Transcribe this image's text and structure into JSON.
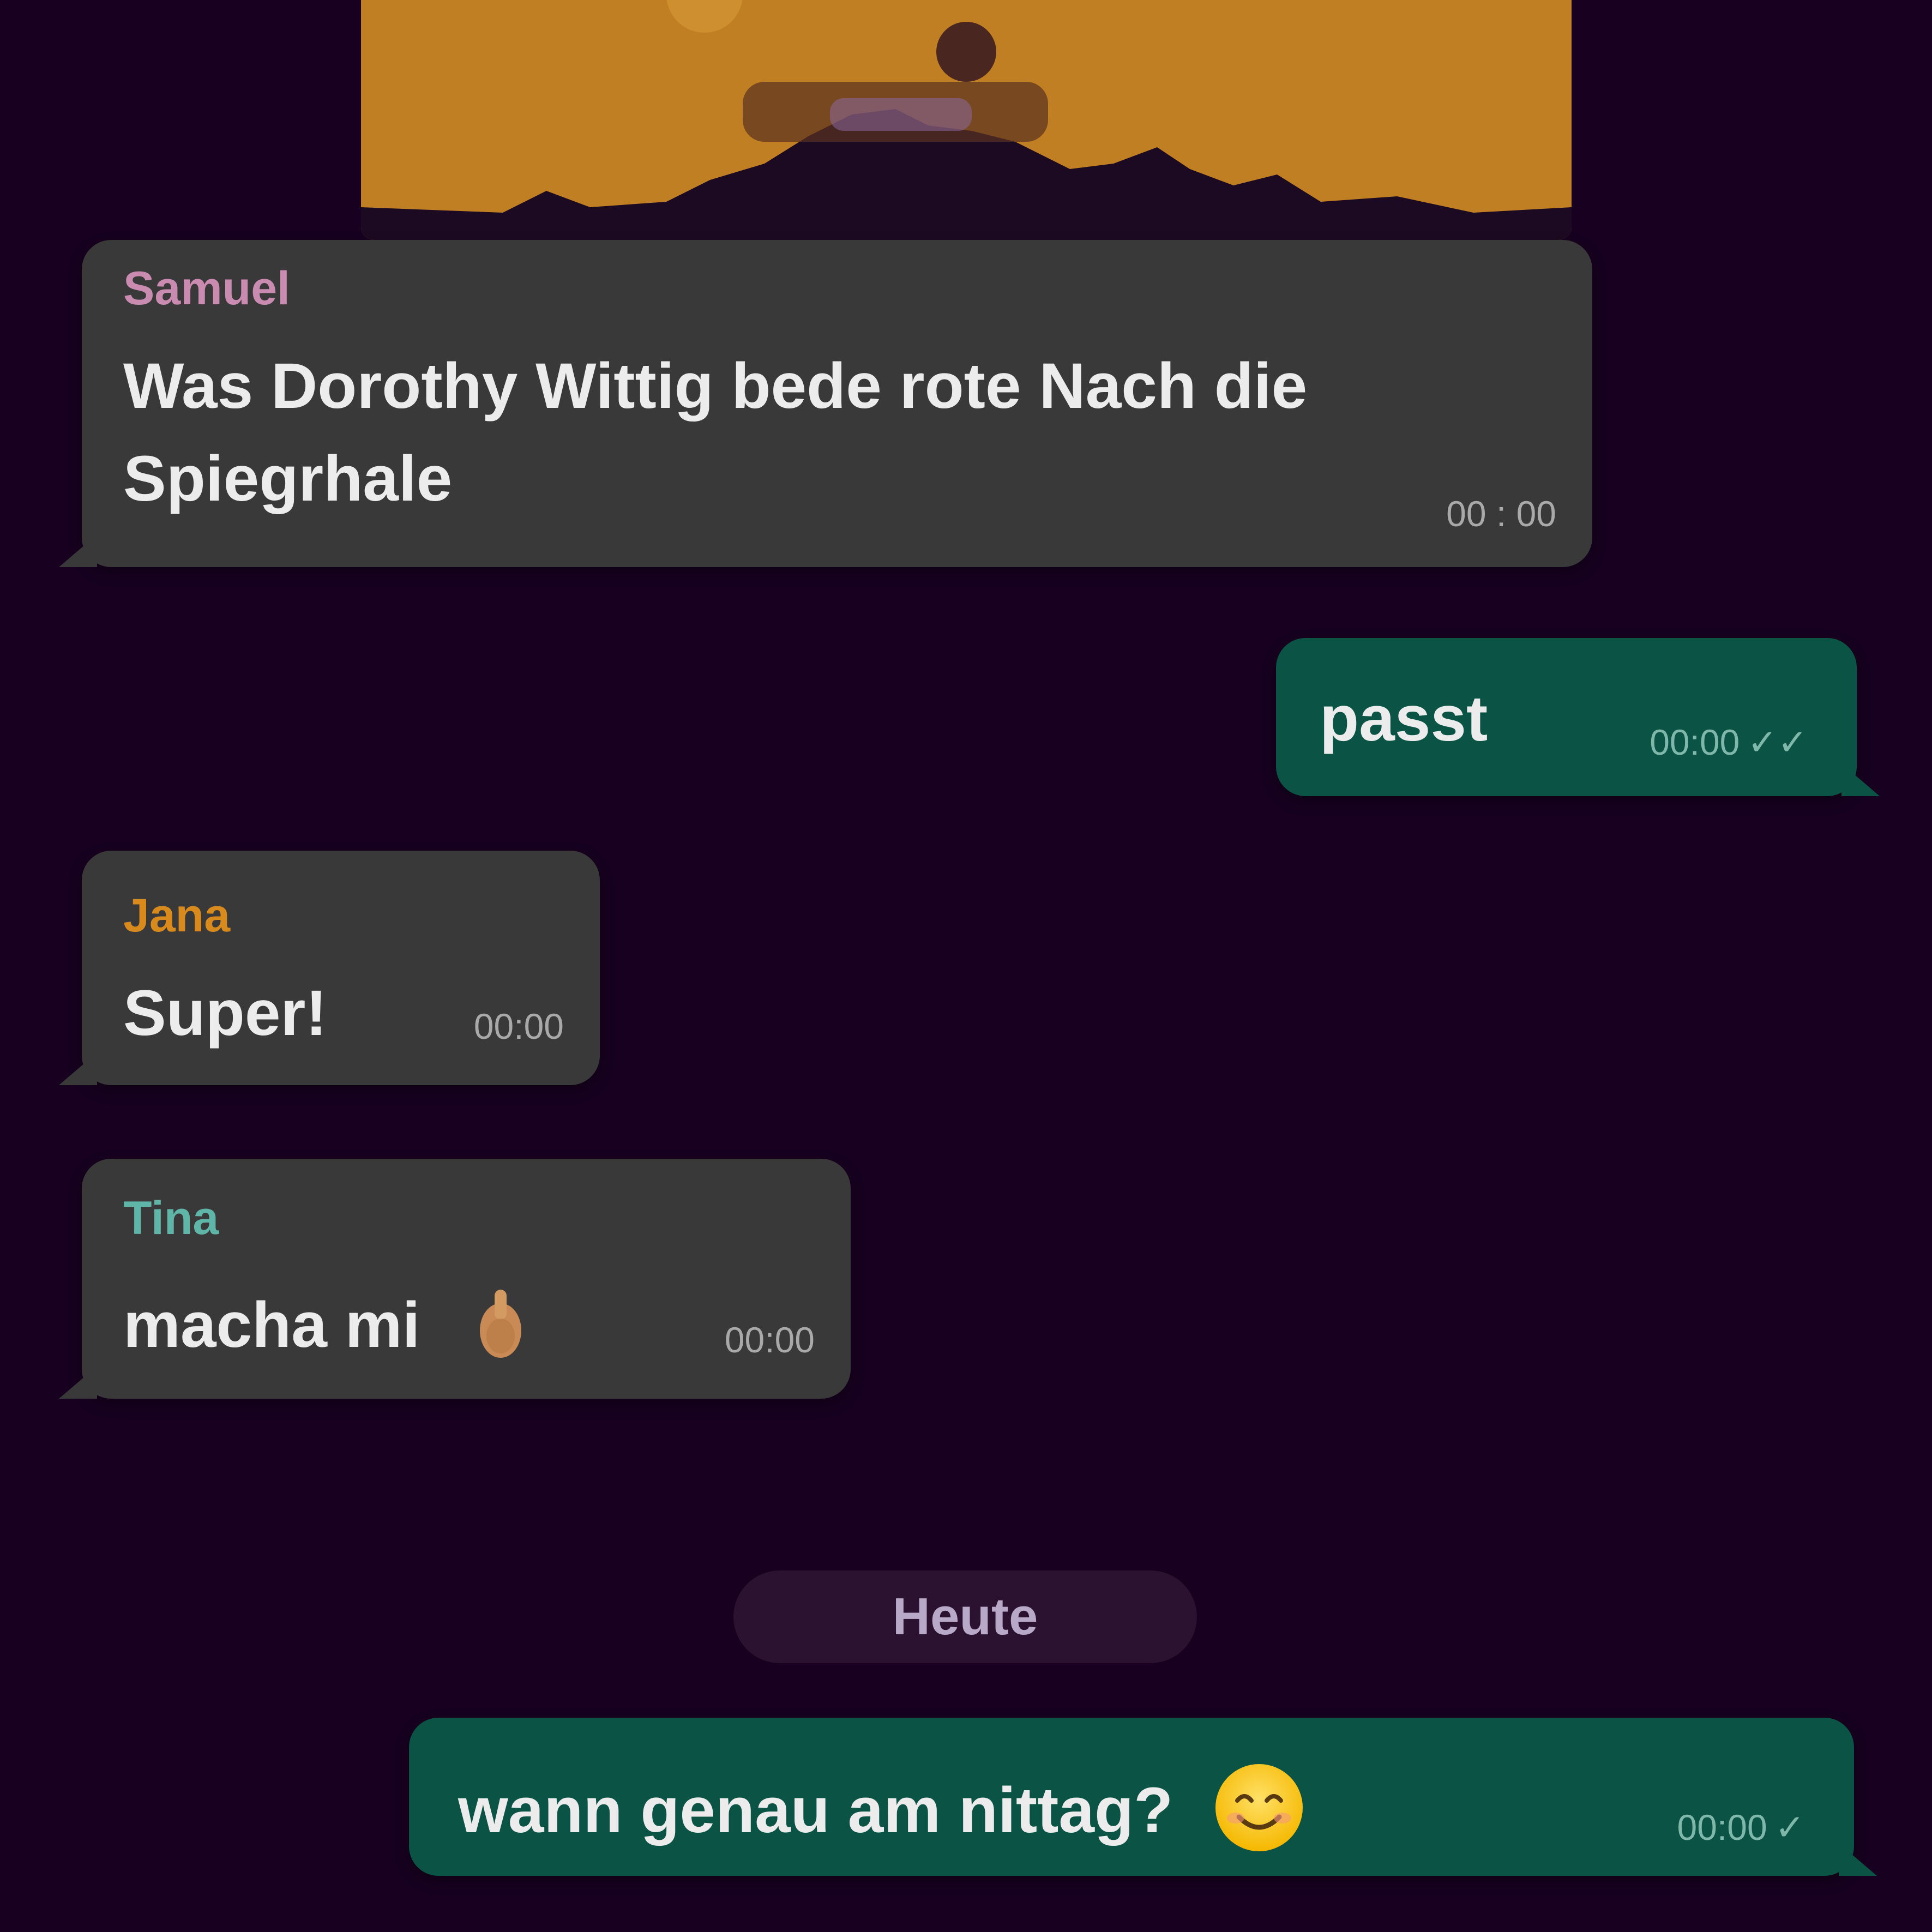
{
  "messages": [
    {
      "sender": "Samuel",
      "sender_color": "#c98bb0",
      "line1": "Was Dorothy Wittig bede rote Nach die",
      "line2": "Spiegrhale",
      "time": "00 : 00"
    },
    {
      "text": "passt",
      "time": "00:00",
      "check": "✓✓"
    },
    {
      "sender": "Jana",
      "sender_color": "#d98a1c",
      "text": "Super!",
      "time": "00:00"
    },
    {
      "sender": "Tina",
      "sender_color": "#5fb5a8",
      "text": "macha mi",
      "emoji": "thumbs-up",
      "time": "00:00"
    },
    {
      "text": "wann genau am nittag?",
      "emoji": "smiling-face",
      "time": "00:00",
      "check": "✓"
    }
  ],
  "date_pill": "Heute",
  "colors": {
    "background": "#170020",
    "incoming_bubble": "#393939",
    "outgoing_bubble": "#0b5345",
    "image_sky": "#c07f22"
  }
}
